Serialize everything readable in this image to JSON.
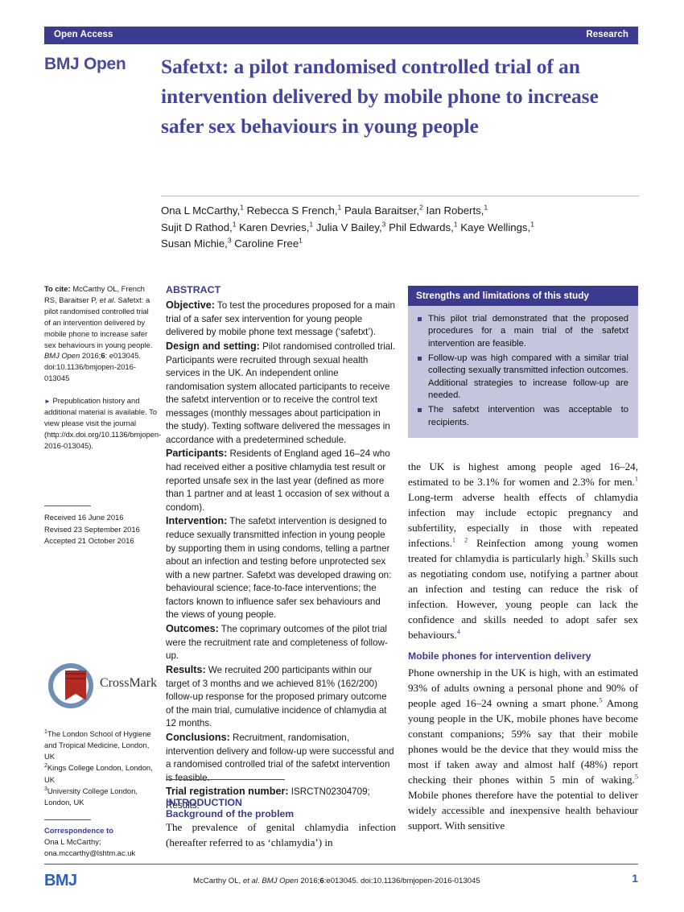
{
  "header": {
    "left_label": "Open Access",
    "right_label": "Research",
    "bar_color": "#3b3b8f"
  },
  "masthead": "BMJ Open",
  "article": {
    "title": "Safetxt: a pilot randomised controlled trial of an intervention delivered by mobile phone to increase safer sex behaviours in young people",
    "title_color": "#45459b",
    "authors_line1": "Ona L McCarthy,",
    "authors_line1_sup1": "1",
    "authors_line1_b": " Rebecca S French,",
    "authors_line1_sup2": "1",
    "authors_line1_c": " Paula Baraitser,",
    "authors_line1_sup3": "2",
    "authors_line1_d": " Ian Roberts,",
    "authors_line1_sup4": "1",
    "authors_line2_a": "Sujit D Rathod,",
    "authors_line2_sup1": "1",
    "authors_line2_b": " Karen Devries,",
    "authors_line2_sup2": "1",
    "authors_line2_c": " Julia V Bailey,",
    "authors_line2_sup3": "3",
    "authors_line2_d": " Phil Edwards,",
    "authors_line2_sup4": "1",
    "authors_line2_e": " Kaye Wellings,",
    "authors_line2_sup5": "1",
    "authors_line3_a": "Susan Michie,",
    "authors_line3_sup1": "3",
    "authors_line3_b": " Caroline Free",
    "authors_line3_sup2": "1"
  },
  "rail": {
    "cite_label": "To cite:",
    "cite_text_a": " McCarthy OL, French RS, Baraitser P, ",
    "cite_etal": "et al",
    "cite_text_b": ". Safetxt: a pilot randomised controlled trial of an intervention delivered by mobile phone to increase safer sex behaviours in young people. ",
    "cite_journal": "BMJ Open",
    "cite_text_c": " 2016;",
    "cite_volume": "6",
    "cite_text_d": ": e013045. doi:10.1136/bmjopen-2016-013045",
    "prepub_arrow": "►",
    "prepub_text": " Prepublication history and additional material is available. To view please visit the journal (http://dx.doi.org/10.1136/bmjopen-2016-013045).",
    "received": "Received 16 June 2016",
    "revised": "Revised 23 September 2016",
    "accepted": "Accepted 21 October 2016"
  },
  "crossmark": {
    "label": "CrossMark",
    "ring_color": "#6f8fb4",
    "ribbon_color": "#b32a23"
  },
  "affiliations": {
    "sup1": "1",
    "aff1": "The London School of Hygiene and Tropical Medicine, London, UK",
    "sup2": "2",
    "aff2": "Kings College London, London, UK",
    "sup3": "3",
    "aff3": "University College London, London, UK",
    "corr_heading": "Correspondence to",
    "corr_name": "Ona L McCarthy;",
    "corr_email": "ona.mccarthy@lshtm.ac.uk"
  },
  "abstract": {
    "heading": "ABSTRACT",
    "sections": [
      {
        "label": "Objective:",
        "text": " To test the procedures proposed for a main trial of a safer sex intervention for young people delivered by mobile phone text message (‘safetxt’)."
      },
      {
        "label": "Design and setting:",
        "text": " Pilot randomised controlled trial. Participants were recruited through sexual health services in the UK. An independent online randomisation system allocated participants to receive the safetxt intervention or to receive the control text messages (monthly messages about participation in the study). Texting software delivered the messages in accordance with a predetermined schedule."
      },
      {
        "label": "Participants:",
        "text": " Residents of England aged 16–24 who had received either a positive chlamydia test result or reported unsafe sex in the last year (defined as more than 1 partner and at least 1 occasion of sex without a condom)."
      },
      {
        "label": "Intervention:",
        "text": " The safetxt intervention is designed to reduce sexually transmitted infection in young people by supporting them in using condoms, telling a partner about an infection and testing before unprotected sex with a new partner. Safetxt was developed drawing on: behavioural science; face-to-face interventions; the factors known to influence safer sex behaviours and the views of young people."
      },
      {
        "label": "Outcomes:",
        "text": " The coprimary outcomes of the pilot trial were the recruitment rate and completeness of follow-up."
      },
      {
        "label": "Results:",
        "text": " We recruited 200 participants within our target of 3 months and we achieved 81% (162/200) follow-up response for the proposed primary outcome of the main trial, cumulative incidence of chlamydia at 12 months."
      },
      {
        "label": "Conclusions:",
        "text": " Recruitment, randomisation, intervention delivery and follow-up were successful and a randomised controlled trial of the safetxt intervention is feasible."
      },
      {
        "label": "Trial registration number:",
        "text": " ISRCTN02304709; Results."
      }
    ]
  },
  "introduction": {
    "heading": "INTRODUCTION",
    "subheading": "Background of the problem",
    "text": "The prevalence of genital chlamydia infection (hereafter referred to as ‘chlamydia’) in"
  },
  "strengths_box": {
    "title": "Strengths and limitations of this study",
    "header_color": "#3b3b8f",
    "body_color": "#c5c5dd",
    "items": [
      "This pilot trial demonstrated that the proposed procedures for a main trial of the safetxt intervention are feasible.",
      "Follow-up was high compared with a similar trial collecting sexually transmitted infection outcomes. Additional strategies to increase follow-up are needed.",
      "The safetxt intervention was acceptable to recipients."
    ]
  },
  "right_column": {
    "para1_a": "the UK is highest among people aged 16–24, estimated to be 3.1% for women and 2.3% for men.",
    "para1_sup1": "1",
    "para1_b": " Long-term adverse health effects of chlamydia infection may include ectopic pregnancy and subfertility, especially in those with repeated infections.",
    "para1_sup2": "1",
    "para1_sup3": "2",
    "para1_c": " Reinfection among young women treated for chlamydia is particularly high.",
    "para1_sup4": "3",
    "para1_d": " Skills such as negotiating condom use, notifying a partner about an infection and testing can reduce the risk of infection. However, young people can lack the confidence and skills needed to adopt safer sex behaviours.",
    "para1_sup5": "4",
    "subheading": "Mobile phones for intervention delivery",
    "para2_a": "Phone ownership in the UK is high, with an estimated 93% of adults owning a personal phone and 90% of people aged 16–24 owning a smart phone.",
    "para2_sup1": "5",
    "para2_b": " Among young people in the UK, mobile phones have become constant companions; 59% say that their mobile phones would be the device that they would miss the most if taken away and almost half (48%) report checking their phones within 5 min of waking.",
    "para2_sup2": "5",
    "para2_c": " Mobile phones therefore have the potential to deliver widely accessible and inexpensive health behaviour support. With sensitive"
  },
  "footer": {
    "logo": "BMJ",
    "citation_a": "McCarthy OL, ",
    "citation_etal": "et al",
    "citation_b": ". ",
    "citation_journal": "BMJ Open",
    "citation_c": " 2016;",
    "citation_volume": "6",
    "citation_d": ":e013045. doi:10.1136/bmjopen-2016-013045",
    "page_number": "1"
  }
}
